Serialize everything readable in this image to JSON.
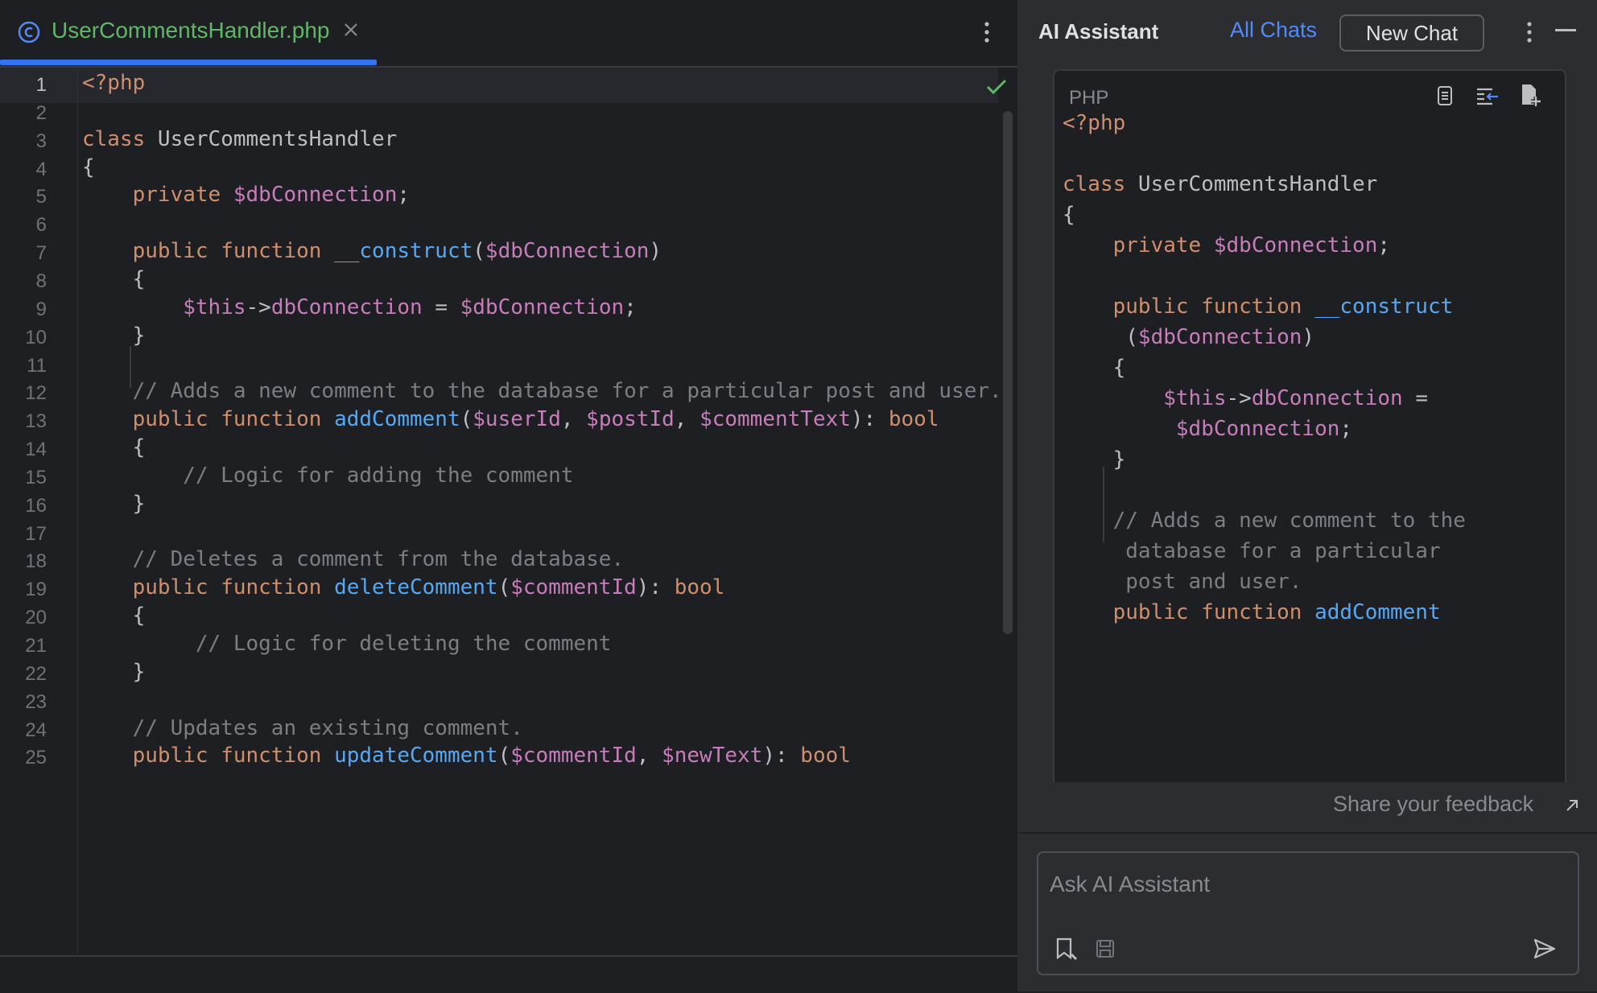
{
  "editor": {
    "tab": {
      "label": "UserCommentsHandler.php",
      "icon": "class-icon"
    },
    "lines": [
      {
        "n": "1",
        "parts": [
          [
            "tag",
            "<?php"
          ]
        ]
      },
      {
        "n": "2",
        "parts": []
      },
      {
        "n": "3",
        "parts": [
          [
            "kw",
            "class "
          ],
          [
            "",
            "UserCommentsHandler"
          ]
        ]
      },
      {
        "n": "4",
        "parts": [
          [
            "",
            "{"
          ]
        ]
      },
      {
        "n": "5",
        "parts": [
          [
            "",
            "    "
          ],
          [
            "kw",
            "private "
          ],
          [
            "var",
            "$dbConnection"
          ],
          [
            "",
            ";"
          ]
        ]
      },
      {
        "n": "6",
        "parts": []
      },
      {
        "n": "7",
        "parts": [
          [
            "",
            "    "
          ],
          [
            "kw",
            "public function "
          ],
          [
            "fn",
            "__construct"
          ],
          [
            "",
            "("
          ],
          [
            "var",
            "$dbConnection"
          ],
          [
            "",
            ")"
          ]
        ]
      },
      {
        "n": "8",
        "parts": [
          [
            "",
            "    {"
          ]
        ]
      },
      {
        "n": "9",
        "parts": [
          [
            "",
            "        "
          ],
          [
            "var",
            "$this"
          ],
          [
            "",
            "->"
          ],
          [
            "var",
            "dbConnection"
          ],
          [
            "",
            " = "
          ],
          [
            "var",
            "$dbConnection"
          ],
          [
            "",
            ";"
          ]
        ]
      },
      {
        "n": "10",
        "parts": [
          [
            "",
            "    }"
          ]
        ]
      },
      {
        "n": "11",
        "parts": []
      },
      {
        "n": "12",
        "parts": [
          [
            "cm",
            "    // Adds a new comment to the database for a particular post and user."
          ]
        ]
      },
      {
        "n": "13",
        "parts": [
          [
            "",
            "    "
          ],
          [
            "kw",
            "public function "
          ],
          [
            "fn",
            "addComment"
          ],
          [
            "",
            "("
          ],
          [
            "var",
            "$userId"
          ],
          [
            "",
            ", "
          ],
          [
            "var",
            "$postId"
          ],
          [
            "",
            ", "
          ],
          [
            "var",
            "$commentText"
          ],
          [
            "",
            "): "
          ],
          [
            "kw",
            "bool"
          ]
        ]
      },
      {
        "n": "14",
        "parts": [
          [
            "",
            "    {"
          ]
        ]
      },
      {
        "n": "15",
        "parts": [
          [
            "cm",
            "        // Logic for adding the comment"
          ]
        ]
      },
      {
        "n": "16",
        "parts": [
          [
            "",
            "    }"
          ]
        ]
      },
      {
        "n": "17",
        "parts": []
      },
      {
        "n": "18",
        "parts": [
          [
            "cm",
            "    // Deletes a comment from the database."
          ]
        ]
      },
      {
        "n": "19",
        "parts": [
          [
            "",
            "    "
          ],
          [
            "kw",
            "public function "
          ],
          [
            "fn",
            "deleteComment"
          ],
          [
            "",
            "("
          ],
          [
            "var",
            "$commentId"
          ],
          [
            "",
            "): "
          ],
          [
            "kw",
            "bool"
          ]
        ]
      },
      {
        "n": "20",
        "parts": [
          [
            "",
            "    {"
          ]
        ]
      },
      {
        "n": "21",
        "parts": [
          [
            "cm",
            "         // Logic for deleting the comment"
          ]
        ]
      },
      {
        "n": "22",
        "parts": [
          [
            "",
            "    }"
          ]
        ]
      },
      {
        "n": "23",
        "parts": []
      },
      {
        "n": "24",
        "parts": [
          [
            "cm",
            "    // Updates an existing comment."
          ]
        ]
      },
      {
        "n": "25",
        "parts": [
          [
            "",
            "    "
          ],
          [
            "kw",
            "public function "
          ],
          [
            "fn",
            "updateComment"
          ],
          [
            "",
            "("
          ],
          [
            "var",
            "$commentId"
          ],
          [
            "",
            ", "
          ],
          [
            "var",
            "$newText"
          ],
          [
            "",
            "): "
          ],
          [
            "kw",
            "bool"
          ]
        ]
      }
    ]
  },
  "assistant": {
    "title": "AI Assistant",
    "all_chats": "All Chats",
    "new_chat": "New Chat",
    "code_block": {
      "language": "PHP",
      "lines": [
        {
          "parts": [
            [
              "tag",
              "<?php"
            ]
          ]
        },
        {
          "parts": []
        },
        {
          "parts": [
            [
              "kw",
              "class "
            ],
            [
              "",
              "UserCommentsHandler"
            ]
          ]
        },
        {
          "parts": [
            [
              "",
              "{"
            ]
          ]
        },
        {
          "parts": [
            [
              "",
              "    "
            ],
            [
              "kw",
              "private "
            ],
            [
              "var",
              "$dbConnection"
            ],
            [
              "",
              ";"
            ]
          ]
        },
        {
          "parts": []
        },
        {
          "parts": [
            [
              "",
              "    "
            ],
            [
              "kw",
              "public function "
            ],
            [
              "fn",
              "__construct"
            ]
          ]
        },
        {
          "parts": [
            [
              "",
              "     ("
            ],
            [
              "var",
              "$dbConnection"
            ],
            [
              "",
              ")"
            ]
          ]
        },
        {
          "parts": [
            [
              "",
              "    {"
            ]
          ]
        },
        {
          "parts": [
            [
              "",
              "        "
            ],
            [
              "var",
              "$this"
            ],
            [
              "",
              "->"
            ],
            [
              "var",
              "dbConnection"
            ],
            [
              "",
              " ="
            ]
          ]
        },
        {
          "parts": [
            [
              "",
              "         "
            ],
            [
              "var",
              "$dbConnection"
            ],
            [
              "",
              ";"
            ]
          ]
        },
        {
          "parts": [
            [
              "",
              "    }"
            ]
          ]
        },
        {
          "parts": []
        },
        {
          "parts": [
            [
              "cm",
              "    // Adds a new comment to the"
            ]
          ]
        },
        {
          "parts": [
            [
              "cm",
              "     database for a particular"
            ]
          ]
        },
        {
          "parts": [
            [
              "cm",
              "     post and user."
            ]
          ]
        },
        {
          "parts": [
            [
              "",
              "    "
            ],
            [
              "kw",
              "public function "
            ],
            [
              "fn",
              "addComment"
            ]
          ]
        }
      ]
    },
    "feedback": "Share your feedback",
    "input_placeholder": "Ask AI Assistant"
  },
  "colors": {
    "accent": "#3574f0",
    "keyword": "#cf8e6d",
    "variable": "#c77dbb",
    "function": "#56a8f5",
    "comment": "#7a7e85",
    "file_name": "#5fb865"
  }
}
